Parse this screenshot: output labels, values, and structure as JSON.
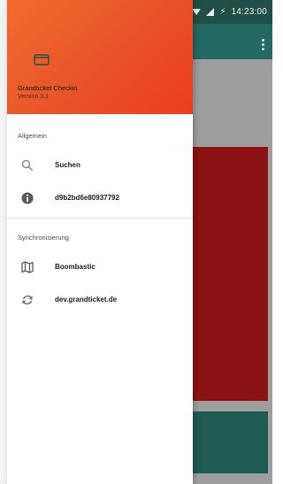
{
  "status_bar": {
    "time": "14:23:00"
  },
  "drawer": {
    "app_name": "Grandticket Checkin",
    "version": "Version 3.1",
    "sections": [
      {
        "title": "Allgemein",
        "items": [
          {
            "label": "Suchen",
            "icon": "search-icon"
          },
          {
            "label": "d9b2bd6e80937792",
            "icon": "info-icon"
          }
        ]
      },
      {
        "title": "Synchronisierung",
        "items": [
          {
            "label": "Boombastic",
            "icon": "map-icon"
          },
          {
            "label": "dev.grandticket.de",
            "icon": "sync-icon"
          }
        ]
      }
    ]
  },
  "colors": {
    "header_gradient_start": "#f16a2c",
    "header_gradient_end": "#ef3e21",
    "toolbar": "#236b62",
    "statusbar": "#1f4f48",
    "background_red_card": "#8b1212"
  }
}
